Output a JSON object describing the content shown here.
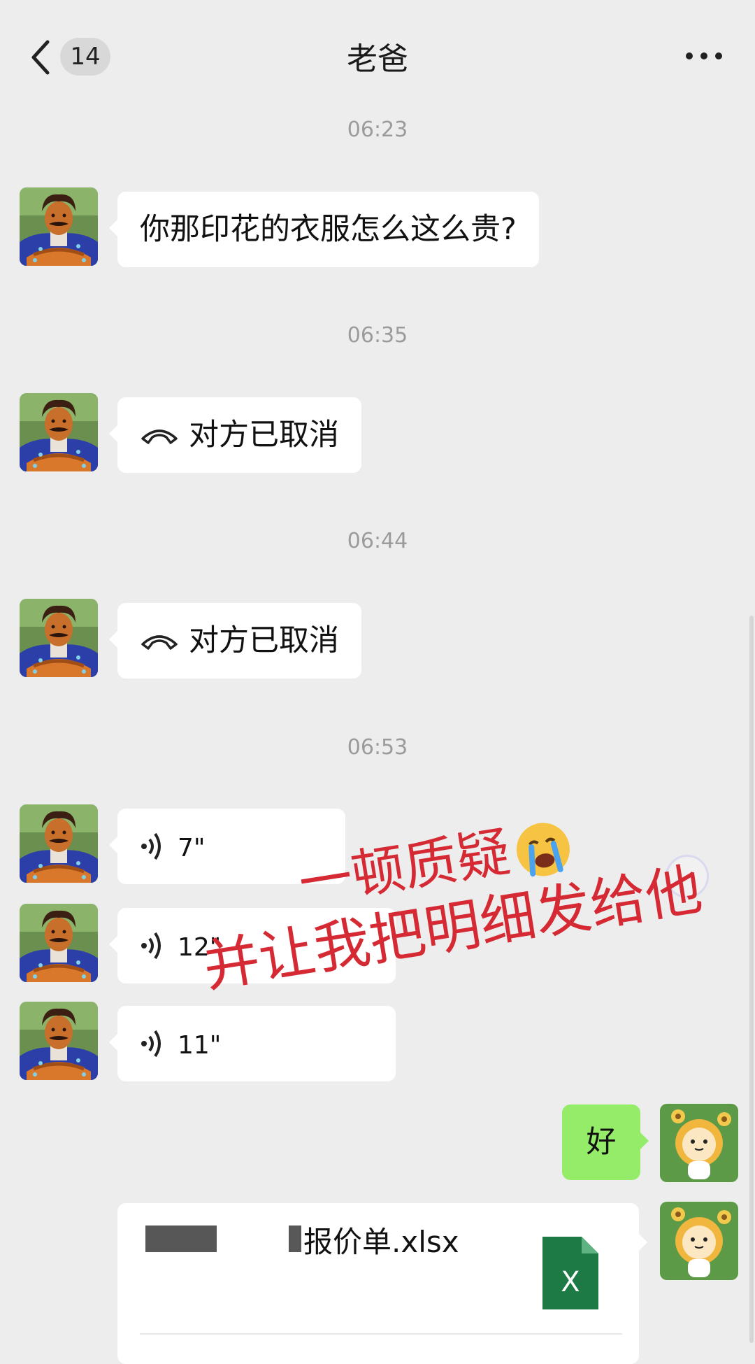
{
  "header": {
    "unread_count": "14",
    "title": "老爸"
  },
  "messages": [
    {
      "time": "06:23",
      "text": "你那印花的衣服怎么这么贵?"
    },
    {
      "time": "06:35",
      "text": "对方已取消"
    },
    {
      "time": "06:44",
      "text": "对方已取消"
    },
    {
      "time": "06:53"
    }
  ],
  "voice_messages": [
    "7\"",
    "12\"",
    "11\""
  ],
  "my_reply": "好",
  "file": {
    "name": "报价单.xlsx",
    "type_letter": "X"
  },
  "overlay": {
    "line1": "一顿质疑",
    "line2": "并让我把明细发给他",
    "color": "#d52a34"
  },
  "colors": {
    "background": "#ededed",
    "my_bubble": "#95ec69",
    "excel_green": "#1d7a45"
  },
  "icons": [
    "back-icon",
    "more-icon",
    "call-declined-icon",
    "voice-icon",
    "excel-file-icon",
    "crying-emoji-icon"
  ]
}
